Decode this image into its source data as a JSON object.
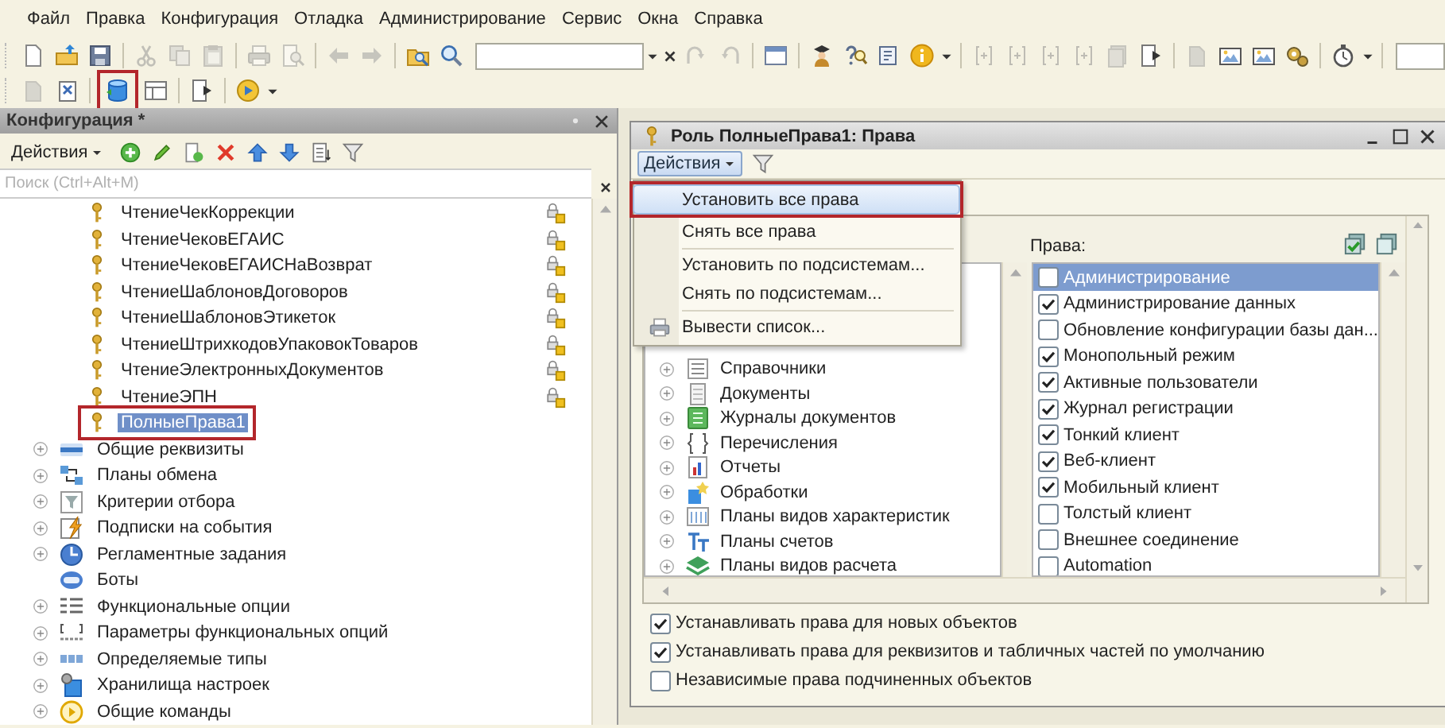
{
  "menu_bar": [
    {
      "label": "Файл"
    },
    {
      "label": "Правка"
    },
    {
      "label": "Конфигурация"
    },
    {
      "label": "Отладка"
    },
    {
      "label": "Администрирование"
    },
    {
      "label": "Сервис"
    },
    {
      "label": "Окна"
    },
    {
      "label": "Справка"
    }
  ],
  "toolbar_1": [
    {
      "kind": "button",
      "disabled": false,
      "highlighted": false
    },
    {
      "kind": "button",
      "disabled": false,
      "highlighted": false
    },
    {
      "kind": "button",
      "disabled": false,
      "highlighted": false
    },
    {
      "kind": "separator"
    },
    {
      "kind": "button",
      "disabled": true,
      "highlighted": false
    },
    {
      "kind": "button",
      "disabled": true,
      "highlighted": false
    },
    {
      "kind": "button",
      "disabled": true,
      "highlighted": false
    },
    {
      "kind": "separator"
    },
    {
      "kind": "button",
      "disabled": true,
      "highlighted": false
    },
    {
      "kind": "button",
      "disabled": true,
      "highlighted": false
    },
    {
      "kind": "separator"
    },
    {
      "kind": "button",
      "disabled": true,
      "highlighted": false
    },
    {
      "kind": "button",
      "disabled": true,
      "highlighted": false
    },
    {
      "kind": "separator"
    },
    {
      "kind": "button",
      "disabled": false,
      "highlighted": false
    },
    {
      "kind": "button",
      "disabled": false,
      "highlighted": false
    },
    {
      "kind": "field"
    },
    {
      "kind": "dropdown"
    },
    {
      "kind": "clear"
    },
    {
      "kind": "button",
      "disabled": true,
      "highlighted": false
    },
    {
      "kind": "button",
      "disabled": true,
      "highlighted": false
    },
    {
      "kind": "separator"
    },
    {
      "kind": "button",
      "disabled": false,
      "highlighted": false
    },
    {
      "kind": "separator"
    },
    {
      "kind": "button",
      "disabled": false,
      "highlighted": false
    },
    {
      "kind": "button",
      "disabled": false,
      "highlighted": false
    },
    {
      "kind": "button",
      "disabled": false,
      "highlighted": false
    },
    {
      "kind": "button",
      "disabled": false,
      "highlighted": false
    },
    {
      "kind": "dropdown"
    },
    {
      "kind": "separator"
    },
    {
      "kind": "button",
      "disabled": true,
      "highlighted": false
    },
    {
      "kind": "button",
      "disabled": true,
      "highlighted": false
    },
    {
      "kind": "button",
      "disabled": true,
      "highlighted": false
    },
    {
      "kind": "button",
      "disabled": true,
      "highlighted": false
    },
    {
      "kind": "button",
      "disabled": true,
      "highlighted": false
    },
    {
      "kind": "button",
      "disabled": false,
      "highlighted": false
    },
    {
      "kind": "separator"
    },
    {
      "kind": "button",
      "disabled": true,
      "highlighted": false
    },
    {
      "kind": "button",
      "disabled": false,
      "highlighted": false
    },
    {
      "kind": "button",
      "disabled": false,
      "highlighted": false
    },
    {
      "kind": "button",
      "disabled": false,
      "highlighted": false
    },
    {
      "kind": "separator"
    },
    {
      "kind": "button",
      "disabled": false,
      "highlighted": false
    },
    {
      "kind": "dropdown"
    },
    {
      "kind": "separator"
    },
    {
      "kind": "field"
    }
  ],
  "toolbar_2": [
    {
      "kind": "button",
      "disabled": true,
      "highlighted": false
    },
    {
      "kind": "button",
      "disabled": false,
      "highlighted": false
    },
    {
      "kind": "separator"
    },
    {
      "kind": "button",
      "disabled": false,
      "highlighted": true
    },
    {
      "kind": "button",
      "disabled": false,
      "highlighted": false
    },
    {
      "kind": "separator"
    },
    {
      "kind": "button",
      "disabled": false,
      "highlighted": false
    },
    {
      "kind": "separator"
    },
    {
      "kind": "button",
      "disabled": false,
      "highlighted": false
    },
    {
      "kind": "dropdown"
    }
  ],
  "config_panel": {
    "title": "Конфигурация *",
    "actions": {
      "label": "Действия",
      "pressed": false
    },
    "search": {
      "placeholder": "Поиск (Ctrl+Alt+M)"
    },
    "tree": [
      {
        "children": [
          {
            "label": "ЧтениеЧекКоррекции",
            "locked": true,
            "selected": false,
            "highlighted": false
          },
          {
            "label": "ЧтениеЧековЕГАИС",
            "locked": true,
            "selected": false,
            "highlighted": false
          },
          {
            "label": "ЧтениеЧековЕГАИСНаВозврат",
            "locked": true,
            "selected": false,
            "highlighted": false
          },
          {
            "label": "ЧтениеШаблоновДоговоров",
            "locked": true,
            "selected": false,
            "highlighted": false
          },
          {
            "label": "ЧтениеШаблоновЭтикеток",
            "locked": true,
            "selected": false,
            "highlighted": false
          },
          {
            "label": "ЧтениеШтрихкодовУпаковокТоваров",
            "locked": true,
            "selected": false,
            "highlighted": false
          },
          {
            "label": "ЧтениеЭлектронныхДокументов",
            "locked": true,
            "selected": false,
            "highlighted": false
          },
          {
            "label": "ЧтениеЭПН",
            "locked": true,
            "selected": false,
            "highlighted": false
          },
          {
            "label": "ПолныеПрава1",
            "locked": false,
            "selected": true,
            "highlighted": true
          }
        ]
      },
      {
        "label": "Общие реквизиты",
        "expandable": true
      },
      {
        "label": "Планы обмена",
        "expandable": true
      },
      {
        "label": "Критерии отбора",
        "expandable": true
      },
      {
        "label": "Подписки на события",
        "expandable": true
      },
      {
        "label": "Регламентные задания",
        "expandable": true
      },
      {
        "label": "Боты",
        "expandable": false
      },
      {
        "label": "Функциональные опции",
        "expandable": true
      },
      {
        "label": "Параметры функциональных опций",
        "expandable": true
      },
      {
        "label": "Определяемые типы",
        "expandable": true
      },
      {
        "label": "Хранилища настроек",
        "expandable": true
      },
      {
        "label": "Общие команды",
        "expandable": true
      }
    ]
  },
  "role_window": {
    "title": "Роль ПолныеПрава1: Права",
    "actions": {
      "label": "Действия",
      "pressed": true
    },
    "menu": [
      {
        "kind": "item",
        "label": "Установить все права",
        "selected": true,
        "highlighted": true
      },
      {
        "kind": "item",
        "label": "Снять все права",
        "selected": false,
        "highlighted": false
      },
      {
        "kind": "separator"
      },
      {
        "kind": "item",
        "label": "Установить по подсистемам...",
        "selected": false,
        "highlighted": false
      },
      {
        "kind": "item",
        "label": "Снять по подсистемам...",
        "selected": false,
        "highlighted": false
      },
      {
        "kind": "separator"
      },
      {
        "kind": "item",
        "label": "Вывести список...",
        "selected": false,
        "highlighted": false
      }
    ],
    "objects": [
      {
        "label": "Справочники",
        "expandable": true
      },
      {
        "label": "Документы",
        "expandable": true
      },
      {
        "label": "Журналы документов",
        "expandable": true
      },
      {
        "label": "Перечисления",
        "expandable": true
      },
      {
        "label": "Отчеты",
        "expandable": true
      },
      {
        "label": "Обработки",
        "expandable": true
      },
      {
        "label": "Планы видов характеристик",
        "expandable": true
      },
      {
        "label": "Планы счетов",
        "expandable": true
      },
      {
        "label": "Планы видов расчета",
        "expandable": true
      }
    ],
    "rights_label": "Права:",
    "rights": [
      {
        "label": "Администрирование",
        "checked": false,
        "selected": true
      },
      {
        "label": "Администрирование данных",
        "checked": true,
        "selected": false
      },
      {
        "label": "Обновление конфигурации базы дан...",
        "checked": false,
        "selected": false
      },
      {
        "label": "Монопольный режим",
        "checked": true,
        "selected": false
      },
      {
        "label": "Активные пользователи",
        "checked": true,
        "selected": false
      },
      {
        "label": "Журнал регистрации",
        "checked": true,
        "selected": false
      },
      {
        "label": "Тонкий клиент",
        "checked": true,
        "selected": false
      },
      {
        "label": "Веб-клиент",
        "checked": true,
        "selected": false
      },
      {
        "label": "Мобильный клиент",
        "checked": true,
        "selected": false
      },
      {
        "label": "Толстый клиент",
        "checked": false,
        "selected": false
      },
      {
        "label": "Внешнее соединение",
        "checked": false,
        "selected": false
      },
      {
        "label": "Automation",
        "checked": false,
        "selected": false
      }
    ],
    "options": [
      {
        "label": "Устанавливать права для новых объектов",
        "checked": true
      },
      {
        "label": "Устанавливать права для реквизитов и табличных частей по умолчанию",
        "checked": true
      },
      {
        "label": "Независимые права подчиненных объектов",
        "checked": false
      }
    ]
  }
}
